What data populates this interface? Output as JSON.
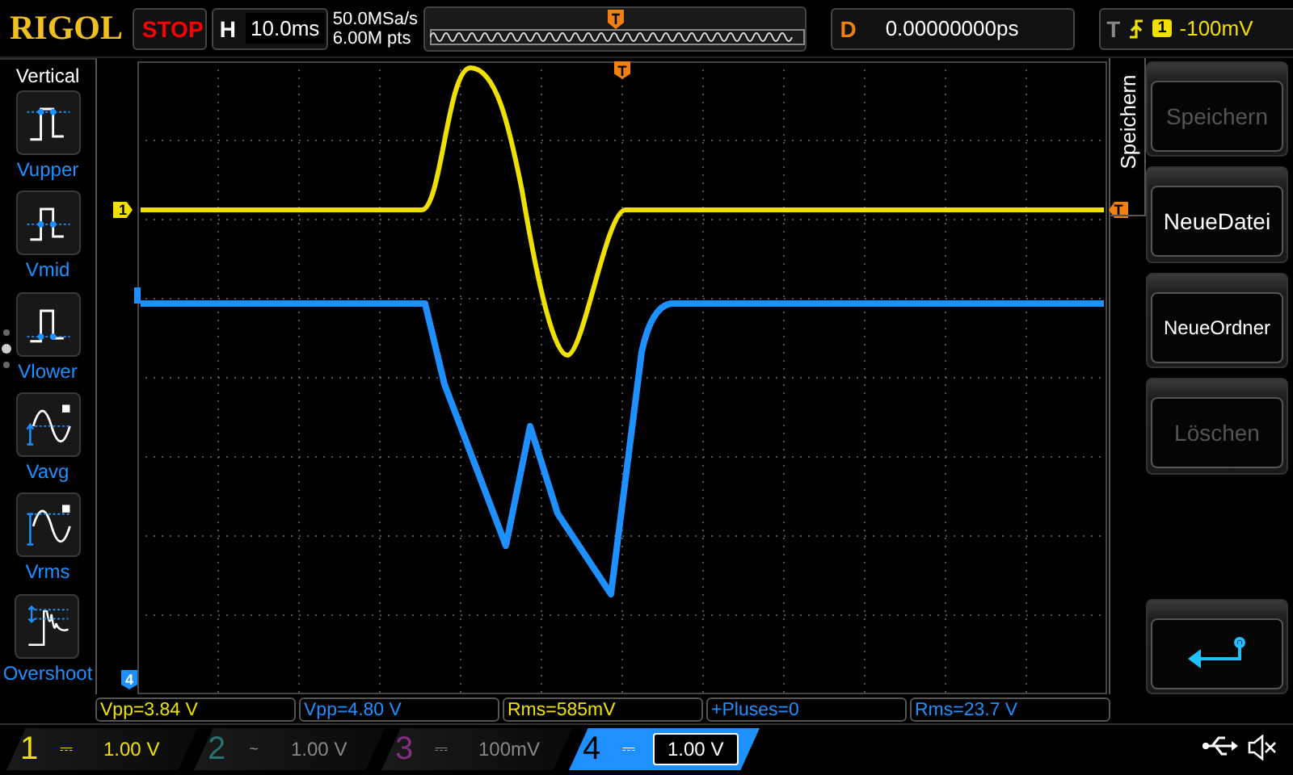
{
  "top_bar": {
    "logo": "RIGOL",
    "run_state": "STOP",
    "horizontal": {
      "label": "H",
      "timebase": "10.0ms"
    },
    "sample_rate": "50.0MSa/s",
    "memory_depth": "6.00M pts",
    "delay": {
      "label": "D",
      "value": "0.00000000ps"
    },
    "trigger": {
      "label": "T",
      "source": "1",
      "level": "-100mV"
    }
  },
  "left_menu": {
    "title": "Vertical",
    "items": [
      {
        "label": "Vupper",
        "kind": "pulse_upper"
      },
      {
        "label": "Vmid",
        "kind": "pulse_mid"
      },
      {
        "label": "Vlower",
        "kind": "pulse_lower"
      },
      {
        "label": "Vavg",
        "kind": "sine_avg"
      },
      {
        "label": "Vrms",
        "kind": "sine_rms"
      },
      {
        "label": "Overshoot",
        "kind": "overshoot"
      }
    ]
  },
  "grid": {
    "channel_marker": "1",
    "trigger_position_marker": "T",
    "trigger_level_marker": "T",
    "channel_4_marker": "4"
  },
  "right_menu": {
    "tab": "Speichern",
    "buttons": [
      {
        "label": "Speichern",
        "kind": "text",
        "disabled": true
      },
      {
        "label": "NeueDatei",
        "kind": "text",
        "disabled": false
      },
      {
        "label": "NeueOrdner",
        "kind": "text",
        "disabled": false
      },
      {
        "label": "Löschen",
        "kind": "text",
        "disabled": true
      },
      {
        "kind": "back"
      }
    ]
  },
  "measurements": [
    {
      "text": "Vpp=3.84 V",
      "color": "#f0e000"
    },
    {
      "text": "Vpp=4.80 V",
      "color": "#1e90ff"
    },
    {
      "text": "Rms=585mV",
      "color": "#f0e000"
    },
    {
      "text": "+Pluses=0",
      "color": "#1e90ff"
    },
    {
      "text": "Rms=23.7 V",
      "color": "#1e90ff"
    }
  ],
  "channels": [
    {
      "number": "1",
      "coupling": "⎓",
      "scale": "1.00 V",
      "color": "#f0e000",
      "on": true,
      "selected": false
    },
    {
      "number": "2",
      "coupling": "~",
      "scale": "1.00 V",
      "color": "#2a7070",
      "on": false,
      "selected": false
    },
    {
      "number": "3",
      "coupling": "⎓",
      "scale": "100mV",
      "color": "#803080",
      "on": false,
      "selected": false
    },
    {
      "number": "4",
      "coupling": "⎓",
      "scale": "1.00 V",
      "color": "#1e90ff",
      "on": true,
      "selected": true
    }
  ]
}
